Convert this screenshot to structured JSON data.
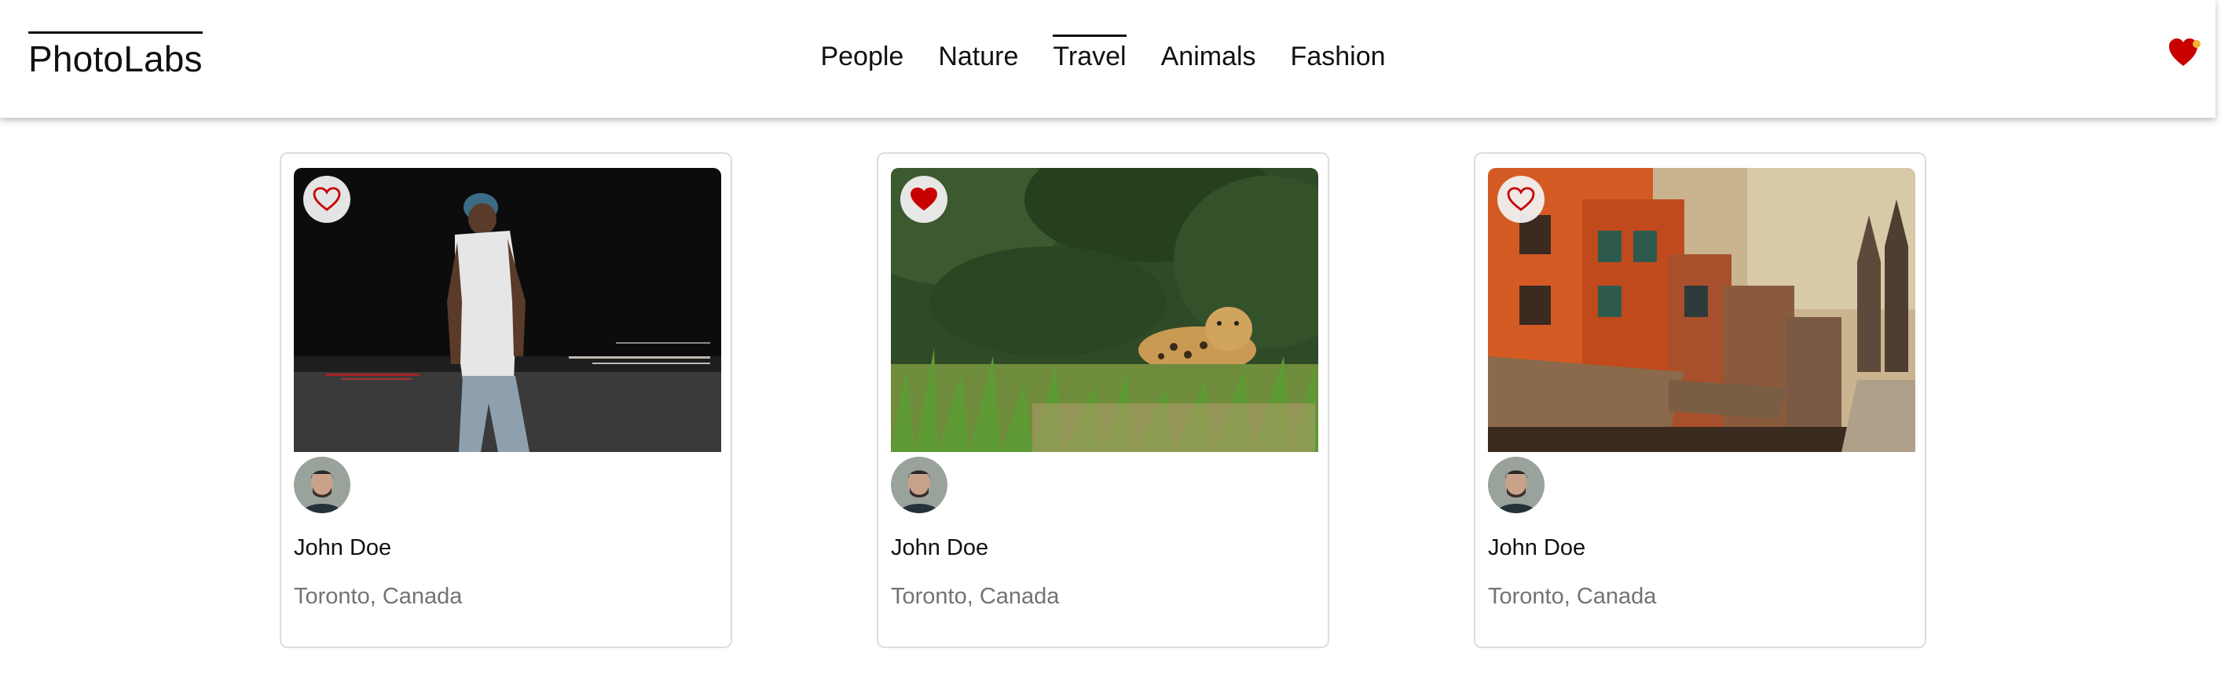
{
  "app": {
    "logo": "PhotoLabs"
  },
  "nav": {
    "items": [
      {
        "label": "People",
        "active": false
      },
      {
        "label": "Nature",
        "active": false
      },
      {
        "label": "Travel",
        "active": true
      },
      {
        "label": "Animals",
        "active": false
      },
      {
        "label": "Fashion",
        "active": false
      }
    ]
  },
  "header": {
    "favorites_icon": "heart-icon",
    "favorites_has_notification": true
  },
  "photos": [
    {
      "user": "John Doe",
      "location": "Toronto, Canada",
      "liked": false,
      "subject": "man-walking-at-night"
    },
    {
      "user": "John Doe",
      "location": "Toronto, Canada",
      "liked": true,
      "subject": "jaguar-in-grass"
    },
    {
      "user": "John Doe",
      "location": "Toronto, Canada",
      "liked": false,
      "subject": "orange-buildings-street"
    }
  ],
  "colors": {
    "heart": "#c80000",
    "notification": "#f2b233",
    "text": "#111111",
    "muted": "#737373",
    "card_border": "#dddddd"
  }
}
